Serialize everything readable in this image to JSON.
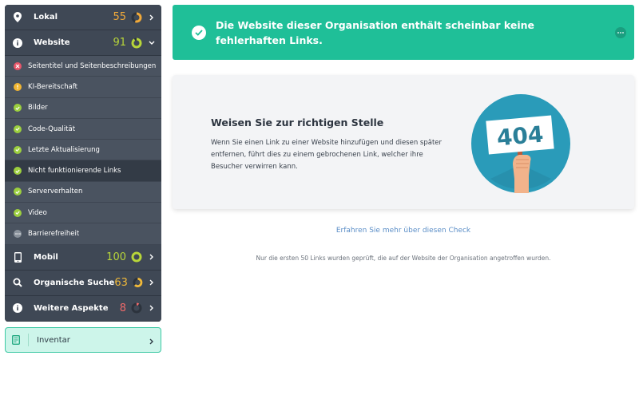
{
  "sidebar": {
    "categories": [
      {
        "label": "Lokal",
        "score": "55",
        "icon": "location-pin-icon",
        "color": "#f0a93a",
        "progress": 0.55
      },
      {
        "label": "Website",
        "score": "91",
        "icon": "info-icon",
        "color": "#b8d63a",
        "progress": 0.91
      }
    ],
    "subitems": [
      {
        "label": "Seitentitel und Seitenbeschreibungen",
        "status": "error"
      },
      {
        "label": "KI-Bereitschaft",
        "status": "warning"
      },
      {
        "label": "Bilder",
        "status": "ok"
      },
      {
        "label": "Code-Qualität",
        "status": "ok"
      },
      {
        "label": "Letzte Aktualisierung",
        "status": "ok"
      },
      {
        "label": "Nicht funktionierende Links",
        "status": "ok"
      },
      {
        "label": "Serververhalten",
        "status": "ok"
      },
      {
        "label": "Video",
        "status": "ok"
      },
      {
        "label": "Barrierefreiheit",
        "status": "pending"
      }
    ],
    "bottom_categories": [
      {
        "label": "Mobil",
        "score": "100",
        "icon": "mobile-icon",
        "color": "#b8d63a",
        "progress": 1.0
      },
      {
        "label": "Organische Suche",
        "score": "63",
        "icon": "search-icon",
        "color": "#f0b93a",
        "progress": 0.63
      },
      {
        "label": "Weitere Aspekte",
        "score": "8",
        "icon": "info-icon",
        "color": "#f06a6a",
        "progress": 0.08
      }
    ],
    "inventar_label": "Inventar"
  },
  "banner": {
    "text": "Die Website dieser Organisation enthält scheinbar keine fehlerhaften Links."
  },
  "card": {
    "title": "Weisen Sie zur richtigen Stelle",
    "body": "Wenn Sie einen Link zu einer Website hinzufügen und diesen später entfernen, führt dies zu einem gebrochenen Link, welcher ihre Besucher verwirren kann.",
    "illustration_text": "404"
  },
  "learn_more": "Erfahren Sie mehr über diesen Check",
  "footnote": "Nur die ersten 50 Links wurden geprüft, die auf der Website der Organisation angetroffen wurden.",
  "colors": {
    "accent": "#1fbf98",
    "sidebar_bg": "#3b4451",
    "ok": "#9ccf3e",
    "error": "#e8566a",
    "warning": "#f2b632",
    "pending": "#8a929c",
    "link": "#5b8ec7"
  }
}
